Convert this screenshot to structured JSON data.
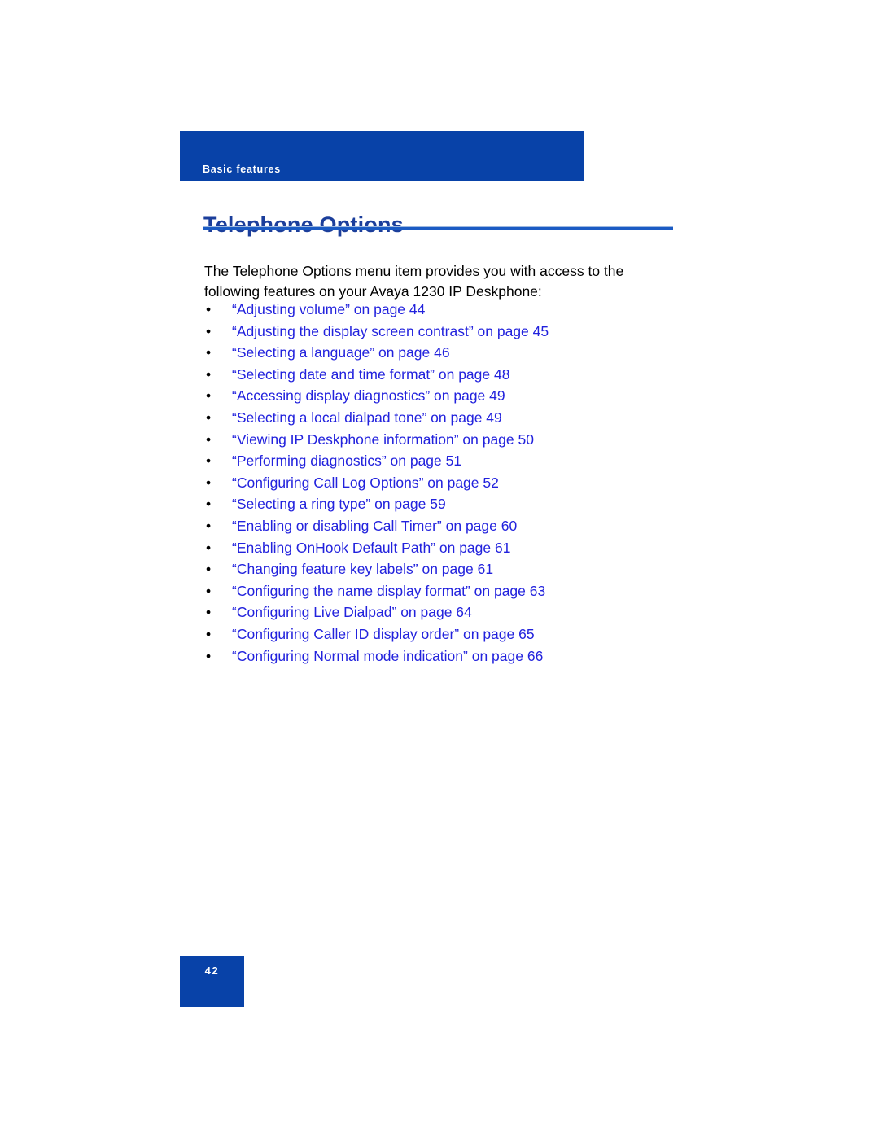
{
  "document": {
    "header_banner": {
      "label": "Basic features",
      "background_color": "#0842A8"
    },
    "title": {
      "text": "Telephone Options",
      "color": "#1B3E9B",
      "rule_color": "#1B5BC4"
    },
    "intro_paragraph": "The Telephone Options menu item provides you with access to the following features on your Avaya 1230 IP Deskphone:",
    "bullet_marker": "•",
    "link_color": "#2222DD",
    "cross_references": [
      {
        "label": "“Adjusting volume” on page 44"
      },
      {
        "label": "“Adjusting the display screen contrast” on page 45"
      },
      {
        "label": "“Selecting a language” on page 46"
      },
      {
        "label": "“Selecting date and time format” on page 48"
      },
      {
        "label": "“Accessing display diagnostics” on page 49"
      },
      {
        "label": "“Selecting a local dialpad tone” on page 49"
      },
      {
        "label": "“Viewing IP Deskphone information” on page 50"
      },
      {
        "label": "“Performing diagnostics” on page 51"
      },
      {
        "label": "“Configuring Call Log Options” on page 52"
      },
      {
        "label": "“Selecting a ring type” on page 59"
      },
      {
        "label": "“Enabling or disabling Call Timer” on page 60"
      },
      {
        "label": "“Enabling OnHook Default Path” on page 61"
      },
      {
        "label": "“Changing feature key labels” on page 61"
      },
      {
        "label": "“Configuring the name display format” on page 63"
      },
      {
        "label": "“Configuring Live Dialpad” on page 64"
      },
      {
        "label": "“Configuring Caller ID display order” on page 65"
      },
      {
        "label": "“Configuring Normal mode indication” on page 66"
      }
    ],
    "footer": {
      "page_number": "42",
      "background_color": "#0842A8"
    }
  }
}
